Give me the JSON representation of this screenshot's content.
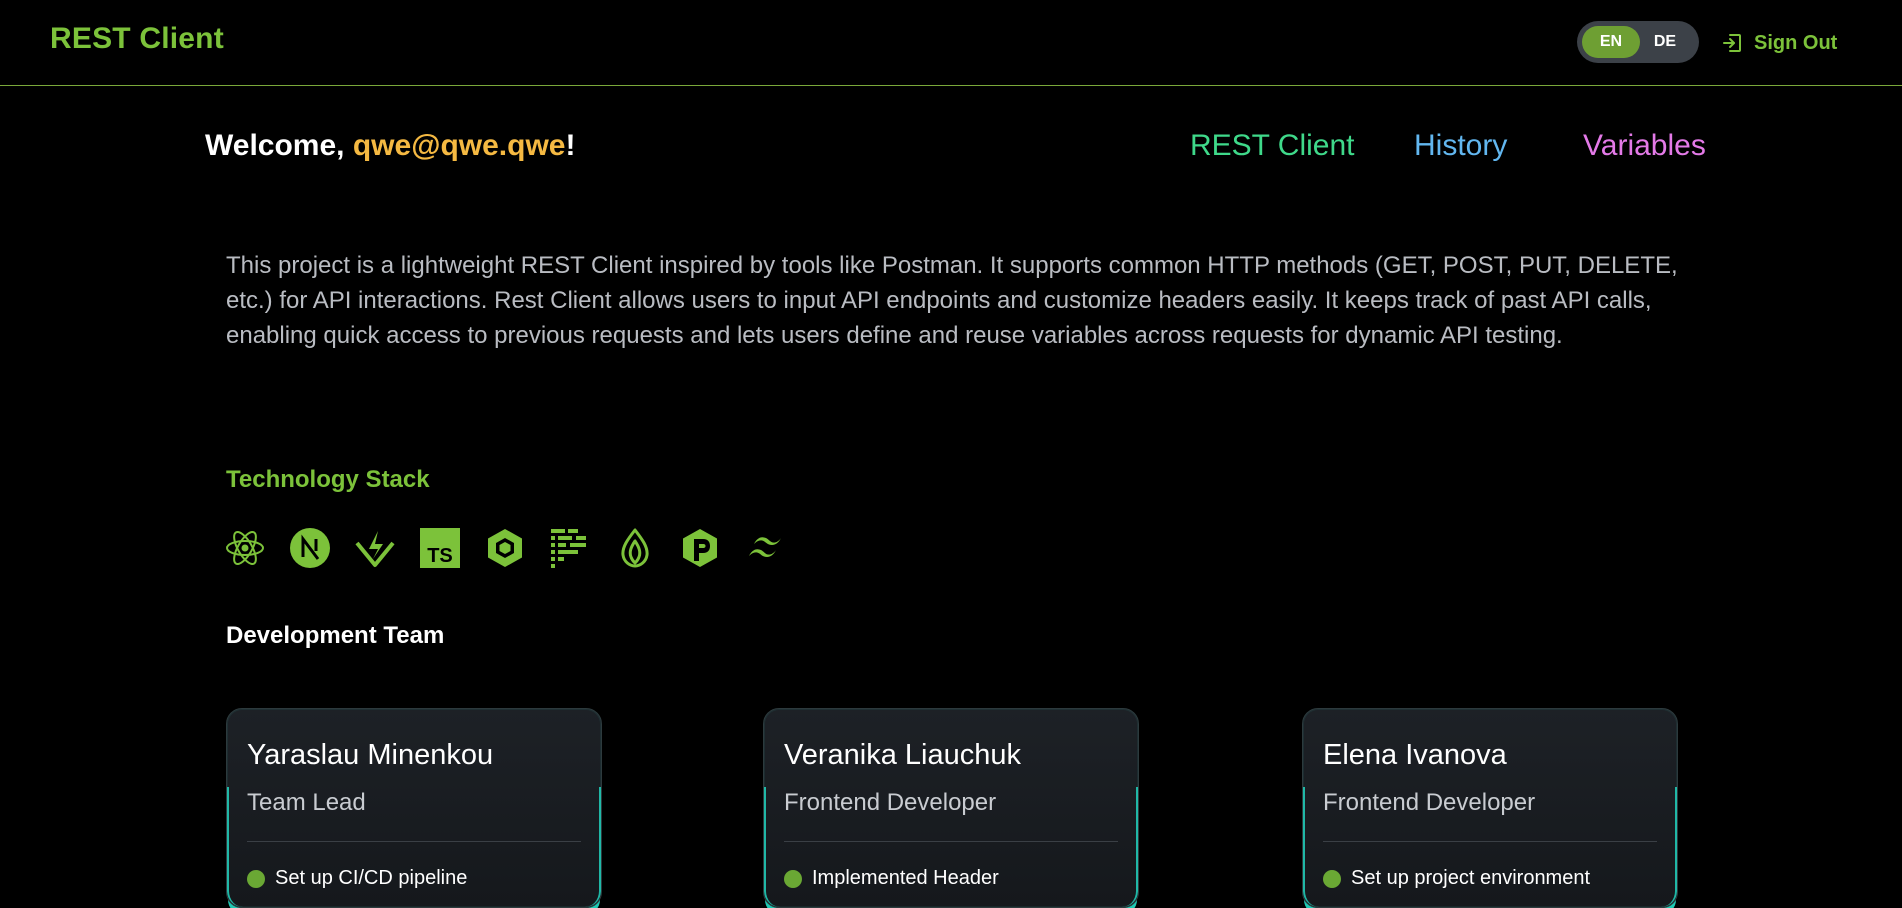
{
  "header": {
    "brand": "REST Client",
    "languages": {
      "en": "EN",
      "de": "DE",
      "active": "EN"
    },
    "sign_out": "Sign Out"
  },
  "welcome": {
    "prefix": "Welcome, ",
    "email": "qwe@qwe.qwe",
    "suffix": "!"
  },
  "nav": {
    "rest_client": "REST Client",
    "history": "History",
    "variables": "Variables"
  },
  "description": "This project is a lightweight REST Client inspired by tools like Postman. It supports common HTTP methods (GET, POST, PUT, DELETE, etc.) for API interactions. Rest Client allows users to input API endpoints and customize headers easily. It keeps track of past API calls, enabling quick access to previous requests and lets users define and reuse variables across requests for dynamic API testing.",
  "tech_stack": {
    "title": "Technology Stack",
    "icons": [
      "react-icon",
      "nextjs-icon",
      "vitest-icon",
      "typescript-icon",
      "eslint-icon",
      "prettier-icon",
      "mongodb-icon",
      "pnpm-icon",
      "tailwind-icon"
    ]
  },
  "team": {
    "title": "Development Team",
    "members": [
      {
        "name": "Yaraslau Minenkou",
        "role": "Team Lead",
        "first_item": "Set up CI/CD pipeline"
      },
      {
        "name": "Veranika Liauchuk",
        "role": "Frontend Developer",
        "first_item": "Implemented Header"
      },
      {
        "name": "Elena Ivanova",
        "role": "Frontend Developer",
        "first_item": "Set up project environment"
      }
    ]
  },
  "colors": {
    "brand": "#7cc23a",
    "email": "#f5b942",
    "nav_rest": "#3fd98a",
    "nav_history": "#62b7f0",
    "nav_variables": "#e47ae8",
    "card_glow": "#22d3be"
  }
}
